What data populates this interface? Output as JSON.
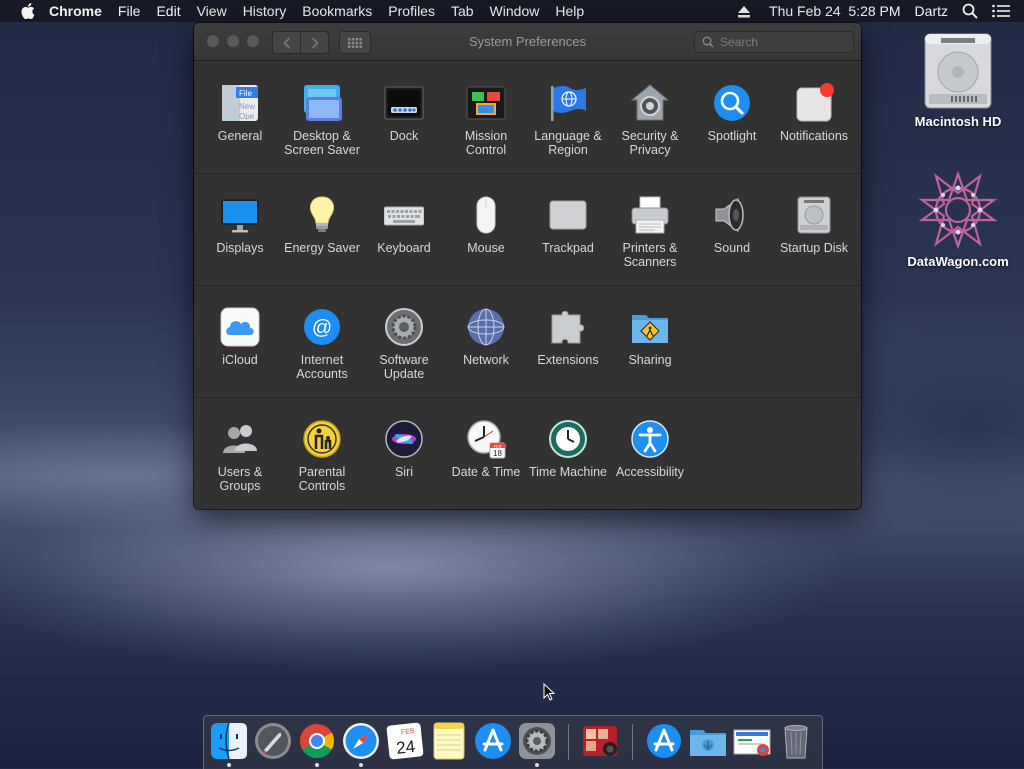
{
  "menubar": {
    "app_name": "Chrome",
    "menus": [
      "File",
      "Edit",
      "View",
      "History",
      "Bookmarks",
      "Profiles",
      "Tab",
      "Window",
      "Help"
    ],
    "clock": "Thu Feb 24  5:28 PM",
    "user": "Dartz"
  },
  "desktop": {
    "icons": [
      {
        "label": "Macintosh HD",
        "icon": "hard-drive-icon"
      },
      {
        "label": "DataWagon.com",
        "icon": "network-share-icon"
      }
    ]
  },
  "window": {
    "title": "System Preferences",
    "search_placeholder": "Search",
    "sections": [
      [
        {
          "label": "General",
          "icon": "general-icon"
        },
        {
          "label": "Desktop & Screen Saver",
          "icon": "desktop-icon"
        },
        {
          "label": "Dock",
          "icon": "dock-icon"
        },
        {
          "label": "Mission Control",
          "icon": "mission-control-icon"
        },
        {
          "label": "Language & Region",
          "icon": "language-flag-icon"
        },
        {
          "label": "Security & Privacy",
          "icon": "security-house-icon"
        },
        {
          "label": "Spotlight",
          "icon": "spotlight-icon"
        },
        {
          "label": "Notifications",
          "icon": "notifications-icon"
        }
      ],
      [
        {
          "label": "Displays",
          "icon": "displays-icon"
        },
        {
          "label": "Energy Saver",
          "icon": "lightbulb-icon"
        },
        {
          "label": "Keyboard",
          "icon": "keyboard-icon"
        },
        {
          "label": "Mouse",
          "icon": "mouse-icon"
        },
        {
          "label": "Trackpad",
          "icon": "trackpad-icon"
        },
        {
          "label": "Printers & Scanners",
          "icon": "printer-icon"
        },
        {
          "label": "Sound",
          "icon": "speaker-icon"
        },
        {
          "label": "Startup Disk",
          "icon": "startup-disk-icon"
        }
      ],
      [
        {
          "label": "iCloud",
          "icon": "icloud-icon"
        },
        {
          "label": "Internet Accounts",
          "icon": "at-sign-icon"
        },
        {
          "label": "Software Update",
          "icon": "software-update-gear-icon"
        },
        {
          "label": "Network",
          "icon": "network-globe-icon"
        },
        {
          "label": "Extensions",
          "icon": "puzzle-piece-icon"
        },
        {
          "label": "Sharing",
          "icon": "sharing-folder-icon"
        }
      ],
      [
        {
          "label": "Users & Groups",
          "icon": "users-icon"
        },
        {
          "label": "Parental Controls",
          "icon": "parental-controls-icon"
        },
        {
          "label": "Siri",
          "icon": "siri-icon"
        },
        {
          "label": "Date & Time",
          "icon": "clock-calendar-icon"
        },
        {
          "label": "Time Machine",
          "icon": "time-machine-icon"
        },
        {
          "label": "Accessibility",
          "icon": "accessibility-icon"
        }
      ]
    ],
    "icon_text": {
      "general_file": "File",
      "general_new": "New",
      "general_open": "Ope",
      "calendar_month": "FEB",
      "calendar_day": "18"
    }
  },
  "dock": {
    "calendar_month": "FEB",
    "calendar_day": "24",
    "items": [
      {
        "icon": "finder-icon",
        "running": true
      },
      {
        "icon": "launchpad-icon",
        "running": false
      },
      {
        "icon": "chrome-icon",
        "running": true
      },
      {
        "icon": "safari-icon",
        "running": true
      },
      {
        "icon": "calendar-icon",
        "running": false
      },
      {
        "icon": "notes-icon",
        "running": false
      },
      {
        "icon": "app-store-icon",
        "running": false
      },
      {
        "icon": "system-preferences-icon",
        "running": true
      },
      {
        "icon": "photo-booth-icon",
        "running": false
      },
      {
        "icon": "applications-folder-icon",
        "running": false
      },
      {
        "icon": "downloads-folder-icon",
        "running": false
      },
      {
        "icon": "document-preview-icon",
        "running": false
      },
      {
        "icon": "trash-icon",
        "running": false
      }
    ]
  },
  "colors": {
    "window_bg": "#323232",
    "accent_blue": "#1e8ef0",
    "notification_red": "#ff3b30"
  }
}
